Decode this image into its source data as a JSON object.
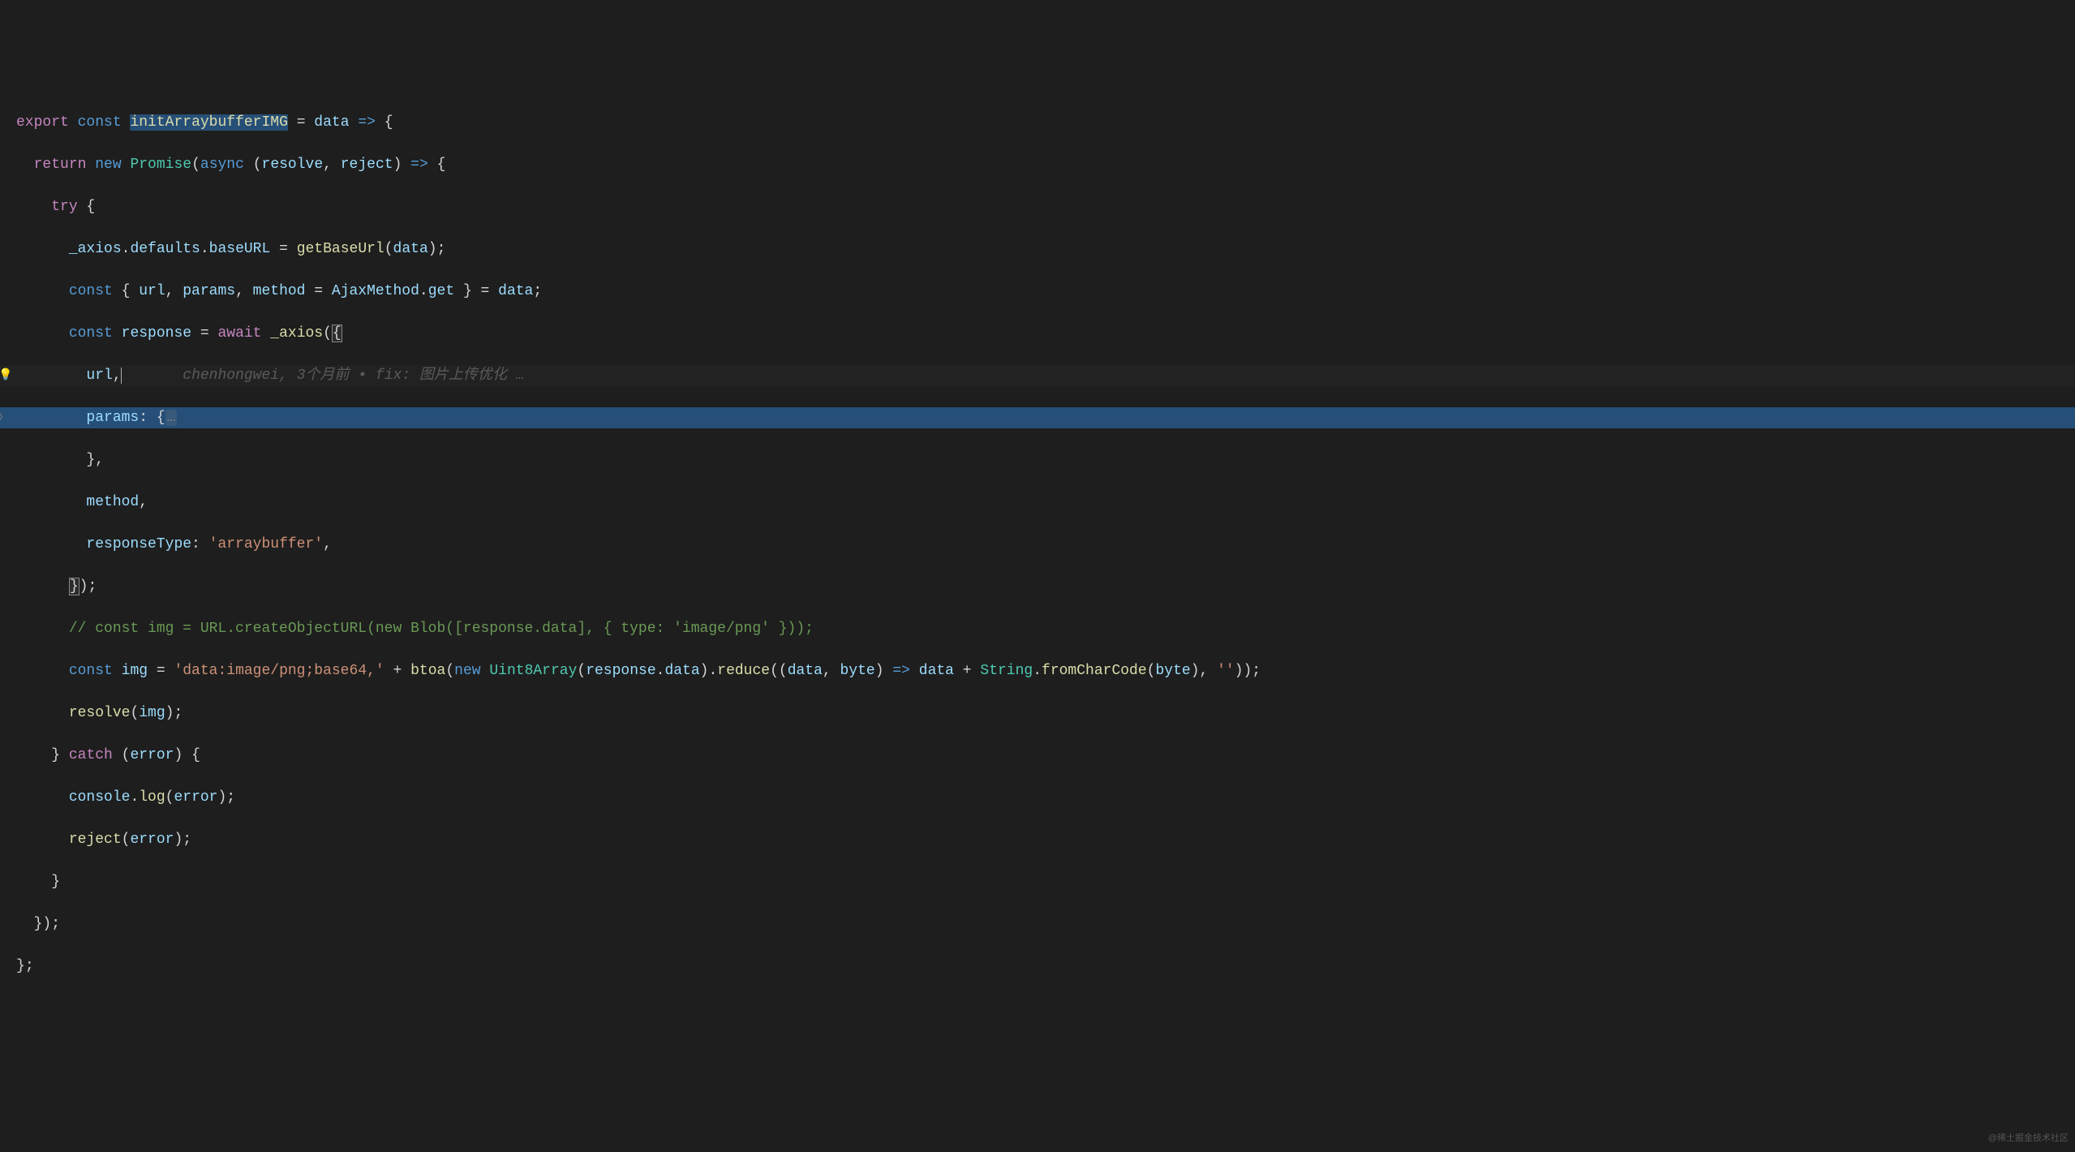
{
  "code": {
    "line1": {
      "export": "export",
      "const": "const",
      "fn_name": "initArraybufferIMG",
      "eq": " = ",
      "param": "data",
      "arrow": " => ",
      "brace": "{"
    },
    "line2": {
      "indent": "  ",
      "return": "return",
      "new": "new",
      "promise": "Promise",
      "paren_open": "(",
      "async": "async",
      "paren_open2": " (",
      "resolve": "resolve",
      "comma": ", ",
      "reject": "reject",
      "paren_close": ") ",
      "arrow": "=>",
      "brace": " {"
    },
    "line3": {
      "indent": "    ",
      "try": "try",
      "brace": " {"
    },
    "line4": {
      "indent": "      ",
      "axios": "_axios",
      "dot1": ".",
      "defaults": "defaults",
      "dot2": ".",
      "baseURL": "baseURL",
      "eq": " = ",
      "getBaseUrl": "getBaseUrl",
      "paren_open": "(",
      "data": "data",
      "paren_close": ")",
      "semi": ";"
    },
    "line5": {
      "indent": "      ",
      "const": "const",
      "brace_open": " { ",
      "url": "url",
      "comma1": ", ",
      "params": "params",
      "comma2": ", ",
      "method": "method",
      "eq": " = ",
      "AjaxMethod": "AjaxMethod",
      "dot": ".",
      "get": "get",
      "brace_close": " } = ",
      "data": "data",
      "semi": ";"
    },
    "line6": {
      "indent": "      ",
      "const": "const",
      "sp": " ",
      "response": "response",
      "eq": " = ",
      "await": "await",
      "sp2": " ",
      "axios": "_axios",
      "paren_open": "(",
      "brace_open": "{"
    },
    "line7": {
      "indent": "        ",
      "url": "url",
      "comma": ",",
      "blame_spacing": "       ",
      "blame": "chenhongwei, 3个月前 • fix: 图片上传优化 …"
    },
    "line8": {
      "indent": "        ",
      "params": "params",
      "colon": ": {",
      "ellipsis": "…"
    },
    "line9": {
      "indent": "        ",
      "brace": "}",
      "comma": ","
    },
    "line10": {
      "indent": "        ",
      "method": "method",
      "comma": ","
    },
    "line11": {
      "indent": "        ",
      "responseType": "responseType",
      "colon": ": ",
      "string": "'arraybuffer'",
      "comma": ","
    },
    "line12": {
      "indent": "      ",
      "brace": "}",
      "paren": ")",
      "semi": ";"
    },
    "line13": {
      "indent": "      ",
      "comment": "// const img = URL.createObjectURL(new Blob([response.data], { type: 'image/png' }));"
    },
    "line14": {
      "indent": "      ",
      "const": "const",
      "sp": " ",
      "img": "img",
      "eq": " = ",
      "string1": "'data:image/png;base64,'",
      "plus": " + ",
      "btoa": "btoa",
      "paren_open": "(",
      "new": "new",
      "sp2": " ",
      "Uint8Array": "Uint8Array",
      "paren_open2": "(",
      "response": "response",
      "dot": ".",
      "data": "data",
      "paren_close2": ")",
      "dot2": ".",
      "reduce": "reduce",
      "paren_open3": "((",
      "data2": "data",
      "comma": ", ",
      "byte": "byte",
      "paren_close3": ") ",
      "arrow": "=>",
      "sp3": " ",
      "data3": "data",
      "plus2": " + ",
      "String": "String",
      "dot3": ".",
      "fromCharCode": "fromCharCode",
      "paren_open4": "(",
      "byte2": "byte",
      "paren_close4": "), ",
      "string2": "''",
      "paren_close5": "));"
    },
    "line15": {
      "indent": "      ",
      "resolve": "resolve",
      "paren_open": "(",
      "img": "img",
      "paren_close": ")",
      "semi": ";"
    },
    "line16": {
      "indent": "    ",
      "brace_close": "}",
      "sp": " ",
      "catch": "catch",
      "paren_open": " (",
      "error": "error",
      "paren_close": ") ",
      "brace_open": "{"
    },
    "line17": {
      "indent": "      ",
      "console": "console",
      "dot": ".",
      "log": "log",
      "paren_open": "(",
      "error": "error",
      "paren_close": ")",
      "semi": ";"
    },
    "line18": {
      "indent": "      ",
      "reject": "reject",
      "paren_open": "(",
      "error": "error",
      "paren_close": ")",
      "semi": ";"
    },
    "line19": {
      "indent": "    ",
      "brace": "}"
    },
    "line20": {
      "indent": "  ",
      "brace": "}",
      "paren": ")",
      "semi": ";"
    },
    "line21": {
      "brace": "}",
      "semi": ";"
    }
  },
  "watermark": "@稀土掘金技术社区"
}
